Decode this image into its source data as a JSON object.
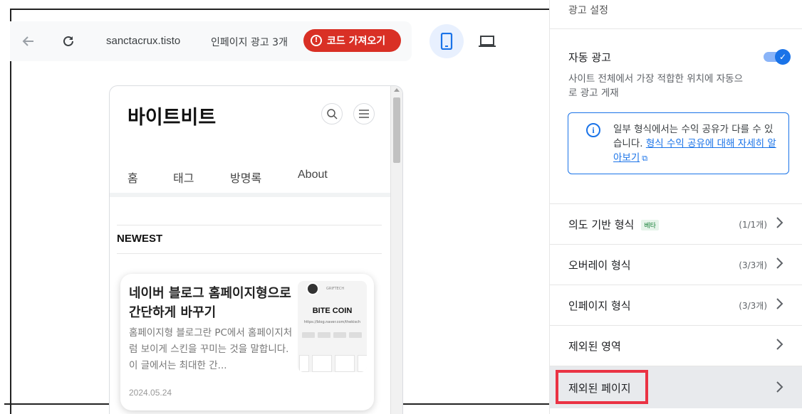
{
  "toolbar": {
    "url": "sanctacrux.tisto",
    "ad_count": "인페이지 광고 3개",
    "code_button": "코드 가져오기",
    "alert_glyph": "!"
  },
  "preview": {
    "blog_title": "바이트비트",
    "nav": [
      "홈",
      "태그",
      "방명록",
      "About"
    ],
    "section_heading": "NEWEST",
    "card": {
      "title": "네이버 블로그 홈페이지형으로 간단하게 바꾸기",
      "description": "홈페이지형 블로그란 PC에서 홈페이지처럼 보이게 스킨을 꾸미는 것을 말합니다. 이 글에서는 최대한 간...",
      "date": "2024.05.24",
      "thumbnail_title": "BITE COIN",
      "thumbnail_url": "https://blog.naver.com/thekisch",
      "thumbnail_brand": "GRIFTECH"
    }
  },
  "panel": {
    "top_label": "광고 설정",
    "auto_ads": {
      "title": "자동 광고",
      "description": "사이트 전체에서 가장 적합한 위치에 자동으로 광고 게재",
      "toggle_on": true,
      "check_glyph": "✓"
    },
    "info": {
      "glyph": "i",
      "text": "일부 형식에서는 수익 공유가 다를 수 있습니다. ",
      "link": "형식 수익 공유에 대해 자세히 알아보기",
      "ext_glyph": "⧉"
    },
    "rows": [
      {
        "label": "의도 기반 형식",
        "badge": "베타",
        "count": "(1/1개)"
      },
      {
        "label": "오버레이 형식",
        "count": "(3/3개)"
      },
      {
        "label": "인페이지 형식",
        "count": "(3/3개)"
      },
      {
        "label": "제외된 영역"
      },
      {
        "label": "제외된 페이지"
      }
    ]
  },
  "colors": {
    "accent": "#1a73e8",
    "danger": "#d93025",
    "highlight": "#ea3344"
  }
}
